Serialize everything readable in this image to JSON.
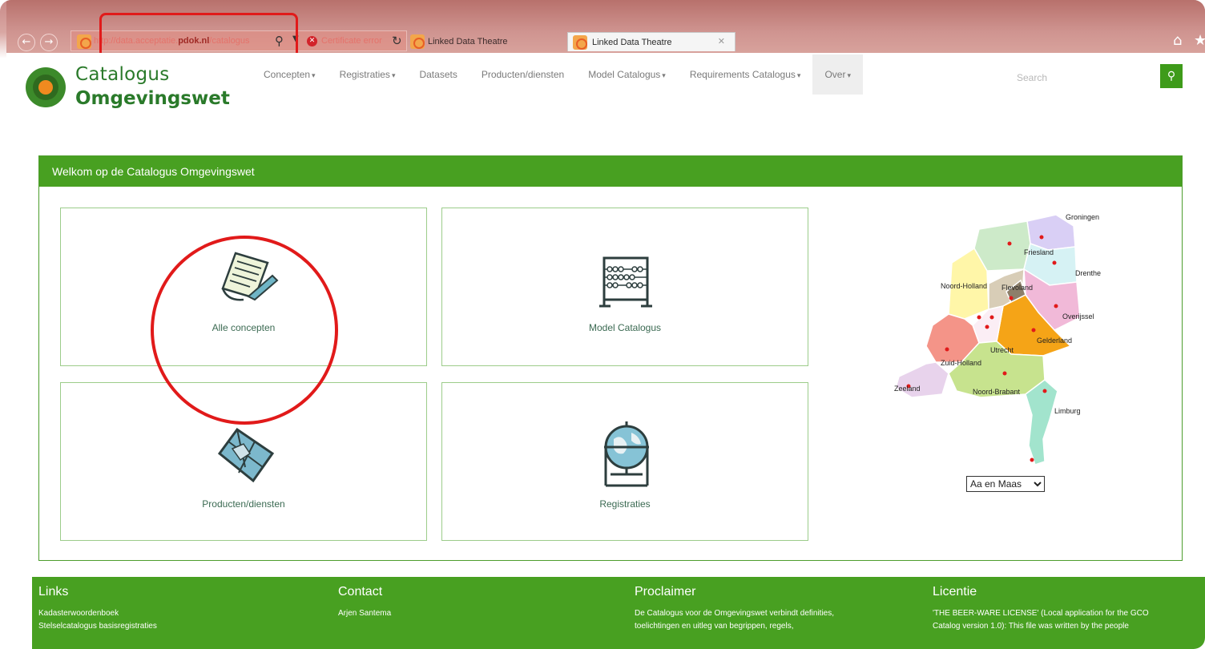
{
  "browser": {
    "address_prefix": "http://data.acceptatie.",
    "address_domain": "pdok.nl",
    "address_suffix": "/catalogus",
    "certificate_text": "Certificate error",
    "tabs": [
      {
        "label": "Linked Data Theatre"
      },
      {
        "label": "Linked Data Theatre"
      }
    ]
  },
  "site": {
    "logo_line1": "Catalogus",
    "logo_line2": "Omgevingswet"
  },
  "nav": {
    "items": [
      {
        "label": "Concepten",
        "dropdown": true
      },
      {
        "label": "Registraties",
        "dropdown": true
      },
      {
        "label": "Datasets",
        "dropdown": false
      },
      {
        "label": "Producten/diensten",
        "dropdown": false
      },
      {
        "label": "Model Catalogus",
        "dropdown": true
      },
      {
        "label": "Requirements Catalogus",
        "dropdown": true
      },
      {
        "label": "Over",
        "dropdown": true
      }
    ]
  },
  "search": {
    "placeholder": "Search"
  },
  "panel": {
    "title": "Welkom op de Catalogus Omgevingswet",
    "tiles": [
      {
        "label": "Alle concepten",
        "icon": "document-pen-icon"
      },
      {
        "label": "Model Catalogus",
        "icon": "abacus-icon"
      },
      {
        "label": "Producten/diensten",
        "icon": "map-icon"
      },
      {
        "label": "Registraties",
        "icon": "globe-icon"
      }
    ]
  },
  "map": {
    "provinces": [
      "Groningen",
      "Friesland",
      "Drenthe",
      "Noord-Holland",
      "Flevoland",
      "Overijssel",
      "Gelderland",
      "Utrecht",
      "Zuid-Holland",
      "Zeeland",
      "Noord-Brabant",
      "Limburg"
    ],
    "select_value": "Aa en Maas"
  },
  "footer": {
    "links_title": "Links",
    "links": [
      "Kadasterwoordenboek",
      "Stelselcatalogus basisregistraties"
    ],
    "contact_title": "Contact",
    "contact_name": "Arjen Santema",
    "proclaimer_title": "Proclaimer",
    "proclaimer_line1": "De Catalogus voor de Omgevingswet verbindt definities,",
    "proclaimer_line2": "toelichtingen en uitleg van begrippen, regels,",
    "licentie_title": "Licentie",
    "licentie_line1": "'THE BEER-WARE LICENSE' (Local application for the GCO",
    "licentie_line2": "Catalog version 1.0): This file was written by the people"
  },
  "colors": {
    "brand_green": "#48a021",
    "annotation_red": "#e11a1a",
    "logo_orange": "#f08a1f"
  }
}
